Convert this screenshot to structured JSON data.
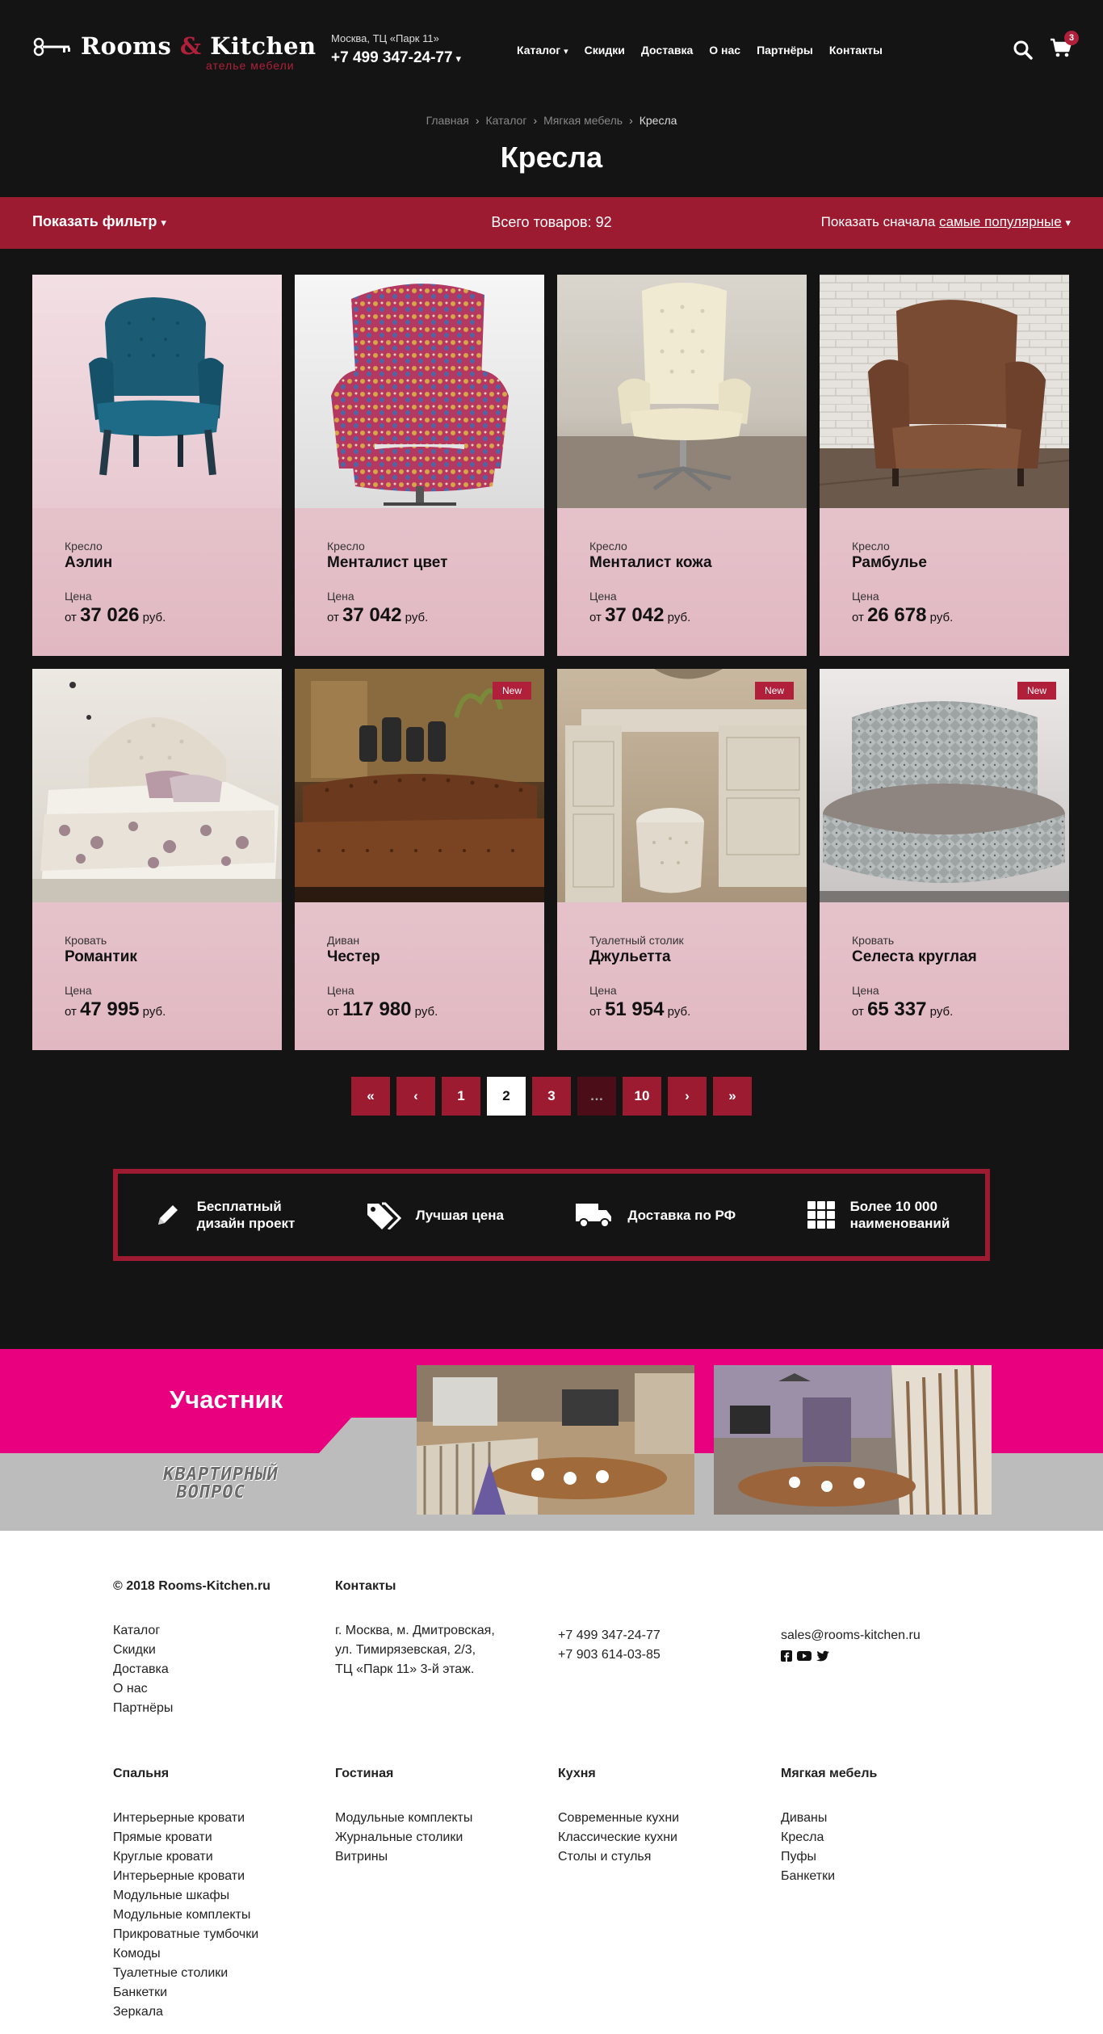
{
  "header": {
    "logo_text_1": "Rooms",
    "logo_amp": "&",
    "logo_text_2": "Kitchen",
    "logo_sub": "ателье мебели",
    "city": "Москва, ТЦ «Парк 11»",
    "phone": "+7 499 347-24-77",
    "nav": [
      "Каталог",
      "Скидки",
      "Доставка",
      "О нас",
      "Партнёры",
      "Контакты"
    ],
    "cart_count": "3"
  },
  "breadcrumb": [
    "Главная",
    "Каталог",
    "Мягкая мебель",
    "Кресла"
  ],
  "page_title": "Кресла",
  "filterbar": {
    "show_filter": "Показать фильтр",
    "total": "Всего товаров: 92",
    "sort_prefix": "Показать сначала",
    "sort_value": "самые популярные"
  },
  "products": [
    {
      "type": "Кресло",
      "name": "Аэлин",
      "price_label": "Цена",
      "from": "от",
      "price": "37 026",
      "currency": "руб.",
      "badge": ""
    },
    {
      "type": "Кресло",
      "name": "Менталист цвет",
      "price_label": "Цена",
      "from": "от",
      "price": "37 042",
      "currency": "руб.",
      "badge": ""
    },
    {
      "type": "Кресло",
      "name": "Менталист кожа",
      "price_label": "Цена",
      "from": "от",
      "price": "37 042",
      "currency": "руб.",
      "badge": ""
    },
    {
      "type": "Кресло",
      "name": "Рамбулье",
      "price_label": "Цена",
      "from": "от",
      "price": "26 678",
      "currency": "руб.",
      "badge": ""
    },
    {
      "type": "Кровать",
      "name": "Романтик",
      "price_label": "Цена",
      "from": "от",
      "price": "47 995",
      "currency": "руб.",
      "badge": ""
    },
    {
      "type": "Диван",
      "name": "Честер",
      "price_label": "Цена",
      "from": "от",
      "price": "117 980",
      "currency": "руб.",
      "badge": "New"
    },
    {
      "type": "Туалетный столик",
      "name": "Джульетта",
      "price_label": "Цена",
      "from": "от",
      "price": "51 954",
      "currency": "руб.",
      "badge": "New"
    },
    {
      "type": "Кровать",
      "name": "Селеста круглая",
      "price_label": "Цена",
      "from": "от",
      "price": "65 337",
      "currency": "руб.",
      "badge": "New"
    }
  ],
  "pagination": {
    "first": "«",
    "prev": "‹",
    "pages": [
      "1",
      "2",
      "3",
      "…",
      "10"
    ],
    "current": "2",
    "next": "›",
    "last": "»"
  },
  "benefits": [
    {
      "icon": "pencil-icon",
      "line1": "Бесплатный",
      "line2": "дизайн проект"
    },
    {
      "icon": "tags-icon",
      "line1": "Лучшая цена",
      "line2": ""
    },
    {
      "icon": "truck-icon",
      "line1": "Доставка по РФ",
      "line2": ""
    },
    {
      "icon": "grid-icon",
      "line1": "Более 10 000",
      "line2": "наименований"
    }
  ],
  "member": {
    "title": "Участник",
    "logo_line1": "КВАРТИРНЫЙ",
    "logo_line2": "ВОПРОС"
  },
  "footer": {
    "copyright": "© 2018 Rooms-Kitchen.ru",
    "links": [
      "Каталог",
      "Скидки",
      "Доставка",
      "О нас",
      "Партнёры"
    ],
    "contacts_title": "Контакты",
    "address": [
      "г. Москва, м. Дмитровская,",
      "ул. Тимирязевская, 2/3,",
      "ТЦ «Парк 11» 3-й этаж."
    ],
    "phones": [
      "+7 499 347-24-77",
      "+7 903 614-03-85"
    ],
    "email": "sales@rooms-kitchen.ru",
    "columns": [
      {
        "title": "Спальня",
        "items": [
          "Интерьерные кровати",
          "Прямые кровати",
          "Круглые кровати",
          "Интерьерные кровати",
          "Модульные шкафы",
          "Модульные комплекты",
          "Прикроватные тумбочки",
          "Комоды",
          "Туалетные столики",
          "Банкетки",
          "Зеркала"
        ]
      },
      {
        "title": "Гостиная",
        "items": [
          "Модульные комплекты",
          "Журнальные столики",
          "Витрины"
        ]
      },
      {
        "title": "Кухня",
        "items": [
          "Современные кухни",
          "Классические кухни",
          "Столы и стулья"
        ]
      },
      {
        "title": "Мягкая мебель",
        "items": [
          "Диваны",
          "Кресла",
          "Пуфы",
          "Банкетки"
        ]
      }
    ]
  },
  "colors": {
    "brand": "#9c1b31",
    "pink": "#e9007f",
    "card": "#e7c7cf",
    "dark": "#141414"
  }
}
